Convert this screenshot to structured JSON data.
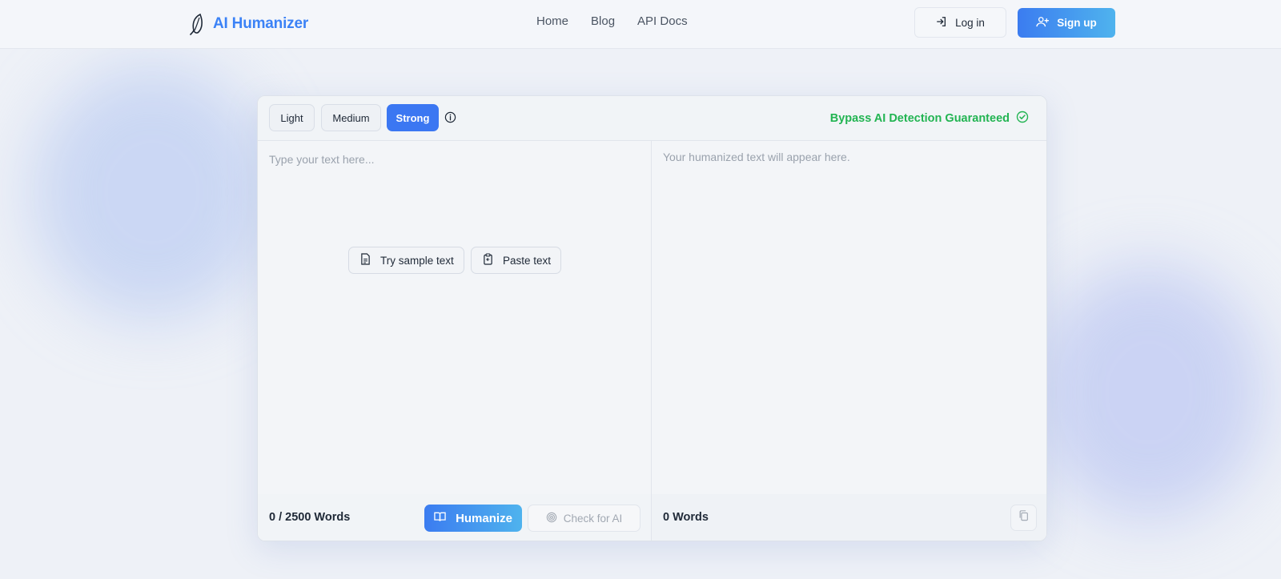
{
  "brand": {
    "name": "AI Humanizer",
    "icon": "feather-icon"
  },
  "nav": {
    "links": [
      "Home",
      "Blog",
      "API Docs"
    ]
  },
  "auth": {
    "login_label": "Log in",
    "signup_label": "Sign up"
  },
  "modes": {
    "items": [
      "Light",
      "Medium",
      "Strong"
    ],
    "selected": "Strong"
  },
  "guarantee": {
    "text": "Bypass AI Detection Guaranteed"
  },
  "input": {
    "placeholder": "Type your text here...",
    "sample_label": "Try sample text",
    "paste_label": "Paste text",
    "word_count": "0 / 2500 Words"
  },
  "actions": {
    "humanize_label": "Humanize",
    "check_label": "Check for AI"
  },
  "output": {
    "placeholder": "Your humanized text will appear here.",
    "word_count": "0 Words"
  },
  "colors": {
    "accent": "#3b77f2",
    "accent_gradient_end": "#4fb3ee",
    "success": "#22b452"
  }
}
